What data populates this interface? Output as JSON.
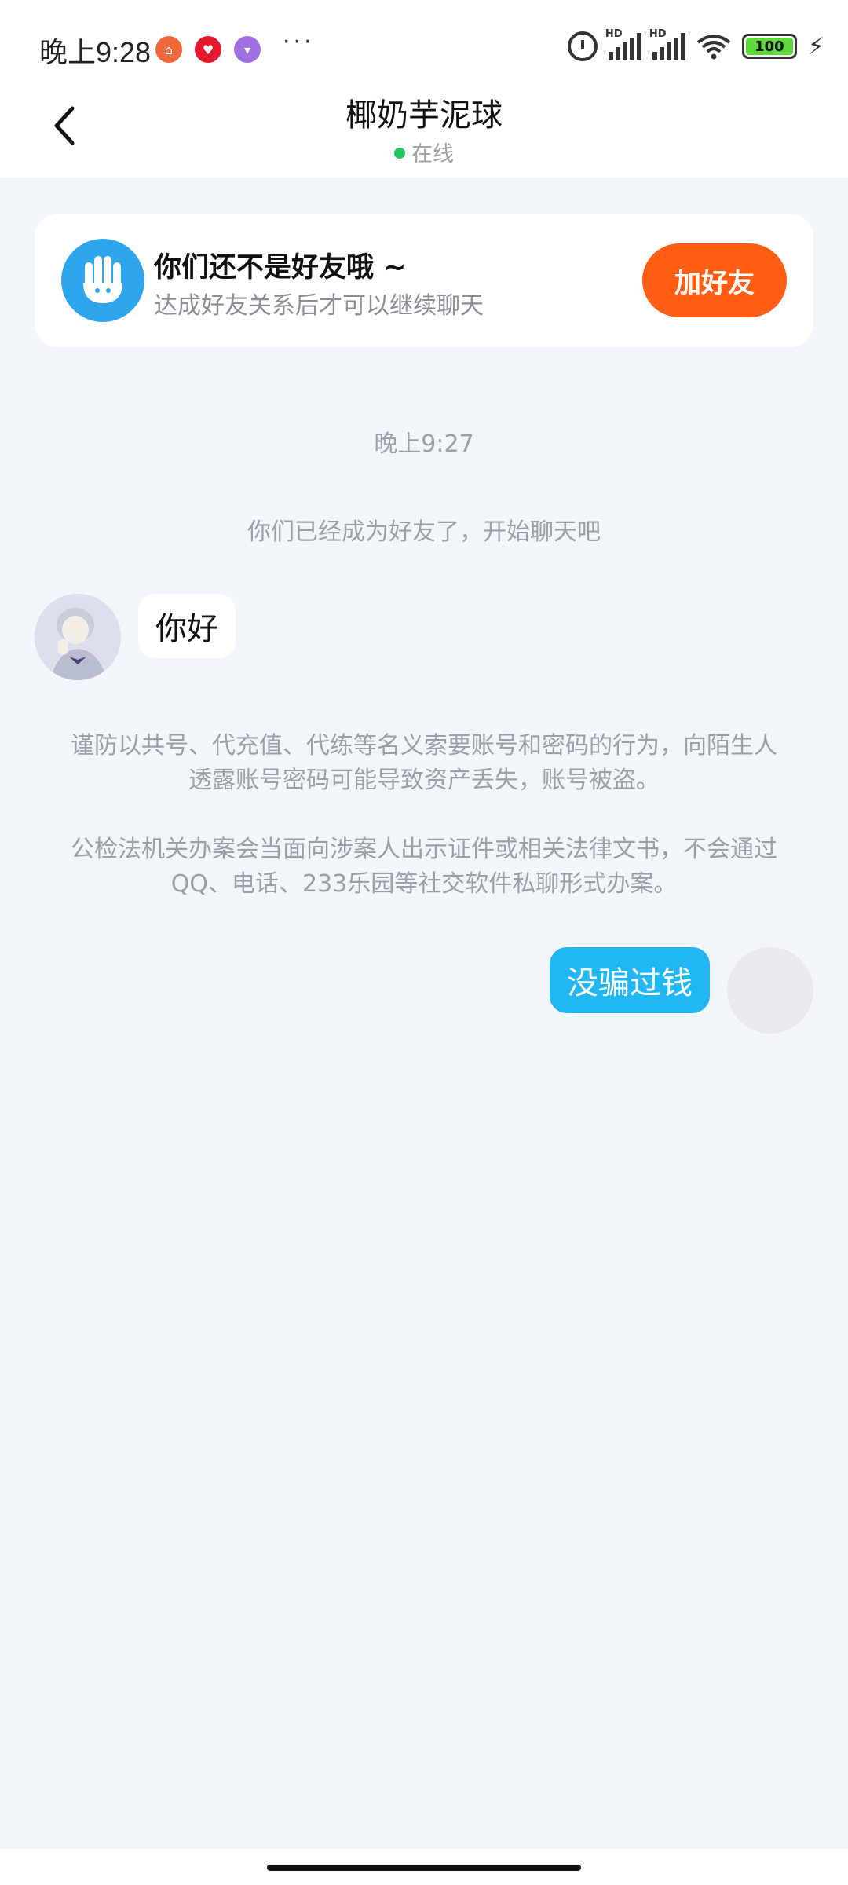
{
  "status_bar": {
    "time": "晚上9:28",
    "battery": "100",
    "more": "···"
  },
  "header": {
    "title": "椰奶芋泥球",
    "status": "在线"
  },
  "banner": {
    "title": "你们还不是好友哦 ~",
    "subtitle": "达成好友关系后才可以继续聊天",
    "add_button_label": "加好友"
  },
  "chat": {
    "timestamp": "晚上9:27",
    "system_message": "你们已经成为好友了，开始聊天吧",
    "incoming_message": "你好",
    "warning_1": "谨防以共号、代充值、代练等名义索要账号和密码的行为，向陌生人透露账号密码可能导致资产丢失，账号被盗。",
    "warning_2": "公检法机关办案会当面向涉案人出示证件或相关法律文书，不会通过QQ、电话、233乐园等社交软件私聊形式办案。",
    "outgoing_message": "没骗过钱"
  },
  "colors": {
    "accent_orange": "#ff5c14",
    "bubble_blue": "#21b6f4",
    "online_green": "#22c55e",
    "background": "#f2f5f9"
  },
  "icons": {
    "back": "chevron-left-icon",
    "alarm": "alarm-icon",
    "signal": "signal-icon",
    "wifi": "wifi-icon",
    "battery": "battery-icon",
    "charging": "bolt-icon",
    "banner": "hand-wave-icon"
  }
}
